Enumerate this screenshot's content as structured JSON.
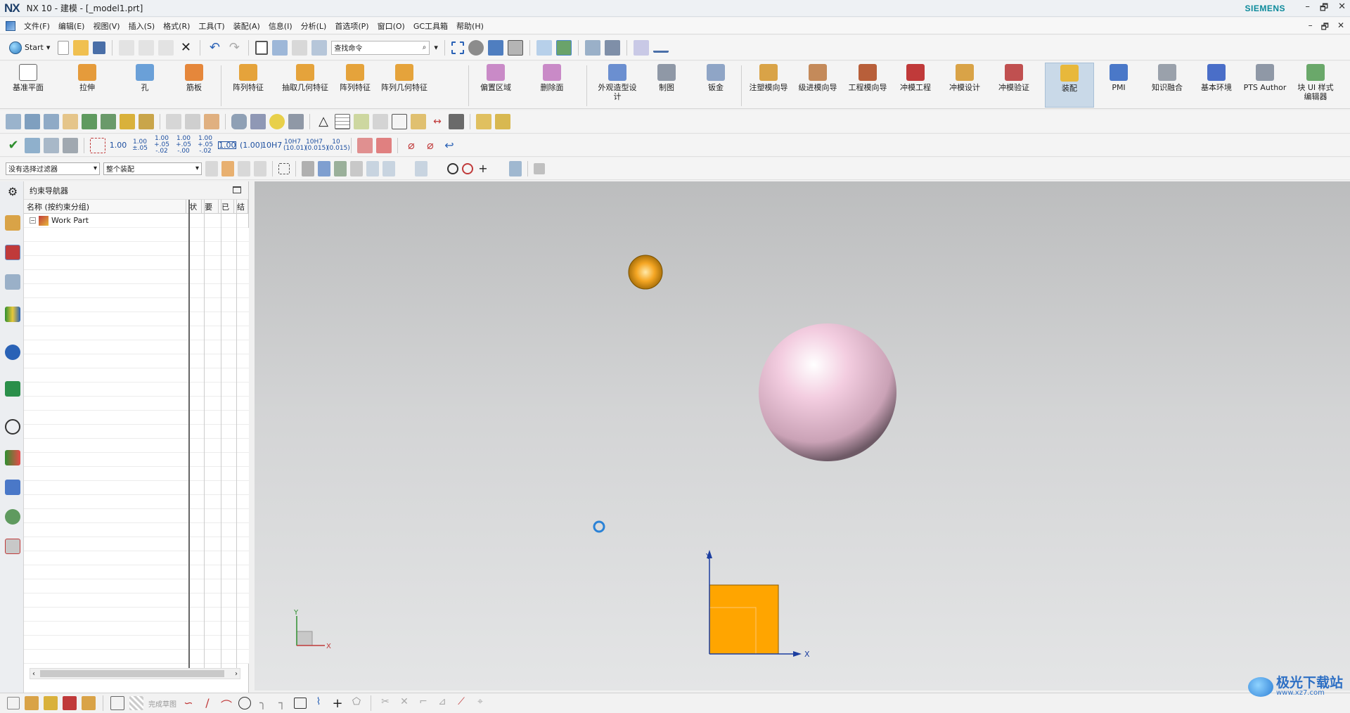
{
  "window": {
    "logo": "NX",
    "title": "NX 10 - 建模 - [_model1.prt]",
    "brand": "SIEMENS",
    "controls": [
      "–",
      "🗗",
      "✕"
    ],
    "sub_controls": [
      "–",
      "🗗",
      "✕"
    ]
  },
  "menu": {
    "items": [
      "文件(F)",
      "编辑(E)",
      "视图(V)",
      "插入(S)",
      "格式(R)",
      "工具(T)",
      "装配(A)",
      "信息(I)",
      "分析(L)",
      "首选项(P)",
      "窗口(O)",
      "GC工具箱",
      "帮助(H)"
    ]
  },
  "quickbar": {
    "start_label": "Start",
    "search_placeholder": "查找命令"
  },
  "ribbon": {
    "buttons": [
      {
        "label": "基准平面",
        "icon": "datum-plane-icon",
        "color": "#ffffff"
      },
      {
        "label": "拉伸",
        "icon": "extrude-icon",
        "color": "#e59b3b"
      },
      {
        "label": "孔",
        "icon": "hole-icon",
        "color": "#6aa0d8"
      },
      {
        "label": "筋板",
        "icon": "rib-icon",
        "color": "#e5873b"
      },
      {
        "label": "阵列特征",
        "icon": "pattern-feature-icon",
        "color": "#e5a33b"
      },
      {
        "label": "抽取几何特征",
        "icon": "extract-geometry-icon",
        "color": "#e5a33b"
      },
      {
        "label": "阵列特征",
        "icon": "pattern-feature-2-icon",
        "color": "#e5a33b"
      },
      {
        "label": "阵列几何特征",
        "icon": "pattern-geometry-icon",
        "color": "#e5a33b"
      },
      {
        "label": "偏置区域",
        "icon": "offset-region-icon",
        "color": "#c98ac7"
      },
      {
        "label": "删除面",
        "icon": "delete-face-icon",
        "color": "#c98ac7"
      },
      {
        "label": "外观造型设计",
        "icon": "shape-studio-icon",
        "color": "#6b8fd0"
      },
      {
        "label": "制图",
        "icon": "drafting-icon",
        "color": "#8f98a6"
      },
      {
        "label": "钣金",
        "icon": "sheet-metal-icon",
        "color": "#8fa5c6"
      },
      {
        "label": "注塑模向导",
        "icon": "mold-wizard-icon",
        "color": "#d9a347"
      },
      {
        "label": "级进模向导",
        "icon": "progressive-die-icon",
        "color": "#c48a5a"
      },
      {
        "label": "工程模向导",
        "icon": "engineering-die-icon",
        "color": "#b85f3a"
      },
      {
        "label": "冲模工程",
        "icon": "die-engineering-icon",
        "color": "#c03a3a"
      },
      {
        "label": "冲模设计",
        "icon": "die-design-icon",
        "color": "#d9a347"
      },
      {
        "label": "冲模验证",
        "icon": "die-validation-icon",
        "color": "#c05050"
      },
      {
        "label": "装配",
        "icon": "assembly-icon",
        "color": "#e8b83b"
      },
      {
        "label": "PMI",
        "icon": "pmi-icon",
        "color": "#4a78c8"
      },
      {
        "label": "知识融合",
        "icon": "knowledge-fusion-icon",
        "color": "#9aa1ab"
      },
      {
        "label": "基本环境",
        "icon": "gateway-icon",
        "color": "#4a6ec8"
      },
      {
        "label": "PTS Author",
        "icon": "pts-author-icon",
        "color": "#8f98a6"
      },
      {
        "label": "块 UI 样式编辑器",
        "icon": "block-ui-styler-icon",
        "color": "#6aa86a"
      }
    ]
  },
  "tolerance": {
    "items": [
      "1.00",
      "1.00 ±.05",
      "1.00 +.05 -.02",
      "1.00 +.05 -.00",
      "1.00 +.05 -.02",
      "1.00",
      "(1.00)",
      "10H7",
      "10H7 (10.01)",
      "10H7 (0.015)",
      "10 (0.015)"
    ]
  },
  "filter": {
    "selection_filter": "没有选择过滤器",
    "scope": "整个装配"
  },
  "navigator": {
    "title": "约束导航器",
    "columns": [
      "名称 (按约束分组)",
      "状",
      "要",
      "已",
      "结"
    ],
    "root": "Work Part"
  },
  "bottombar": {
    "finish_sketch": "完成草图"
  },
  "watermark": {
    "brand": "极光下载站",
    "url": "www.xz7.com"
  },
  "viewport": {
    "axis_labels": {
      "x": "X",
      "y": "Y",
      "x2": "X",
      "y2": "Y"
    },
    "colors": {
      "sphere": "#f2c6d8",
      "cone": "#f5a623",
      "block": "#ffa500",
      "background": "#d3d4d5"
    }
  }
}
